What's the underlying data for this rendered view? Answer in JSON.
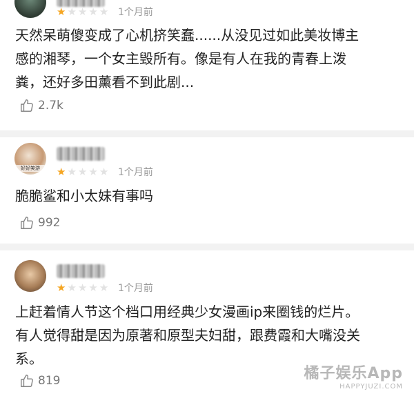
{
  "reviews": [
    {
      "username": "",
      "rating": 1,
      "max_rating": 5,
      "time": "1个月前",
      "text": "天然呆萌傻变成了心机挤笑蠢......从没见过如此美妆博主\n感的湘琴，一个女主毁所有。像是有人在我的青春上泼\n粪，还好多田薰看不到此剧...",
      "likes": "2.7k"
    },
    {
      "username": "",
      "avatar_text": "好好笑游",
      "rating": 1,
      "max_rating": 5,
      "time": "1个月前",
      "text": "脆脆鲨和小太妹有事吗",
      "likes": "992"
    },
    {
      "username": "",
      "rating": 1,
      "max_rating": 5,
      "time": "1个月前",
      "text": "上赶着情人节这个档口用经典少女漫画ip来圈钱的烂片。\n有人觉得甜是因为原著和原型夫妇甜，跟费霞和大嘴没关\n系。",
      "likes": "819"
    }
  ],
  "watermark": {
    "main": "橘子娱乐App",
    "sub": "HAPPYJUZI.COM"
  },
  "icons": {
    "star": "star-icon",
    "like": "thumbs-up-icon"
  },
  "colors": {
    "star_on": "#f5a623",
    "star_off": "#e2e2e2",
    "divider": "#f2f2f2"
  }
}
